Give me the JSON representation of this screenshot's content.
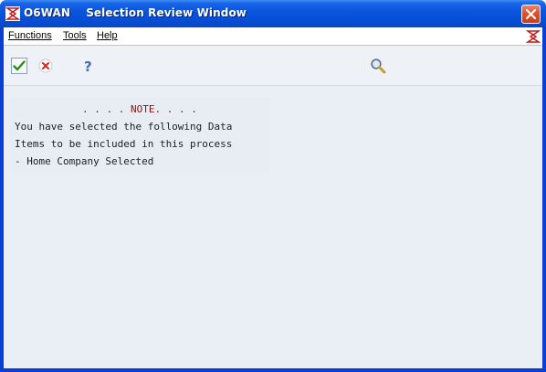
{
  "window": {
    "title": "O6WAN    Selection Review Window"
  },
  "menu": {
    "items": [
      {
        "label": "Functions"
      },
      {
        "label": "Tools"
      },
      {
        "label": "Help"
      }
    ]
  },
  "toolbar": {
    "buttons": [
      {
        "name": "ok",
        "icon": "check-icon",
        "color": "#2f8a1e"
      },
      {
        "name": "cancel",
        "icon": "cancel-icon",
        "color": "#d2281e"
      },
      {
        "name": "help",
        "icon": "question-icon",
        "color": "#3a6fc2"
      },
      {
        "name": "search",
        "icon": "magnifier-icon",
        "color": "#c89b2a"
      }
    ]
  },
  "content": {
    "note_heading": ". . . . NOTE. . . .",
    "lines": [
      "You have selected the following Data",
      "Items to be included in this process",
      "- Home Company Selected"
    ]
  },
  "colors": {
    "title_bar": "#0a55dc",
    "close_button": "#d8532d",
    "content_bg": "#eaeff6",
    "note_heading": "#7a1a1a"
  }
}
